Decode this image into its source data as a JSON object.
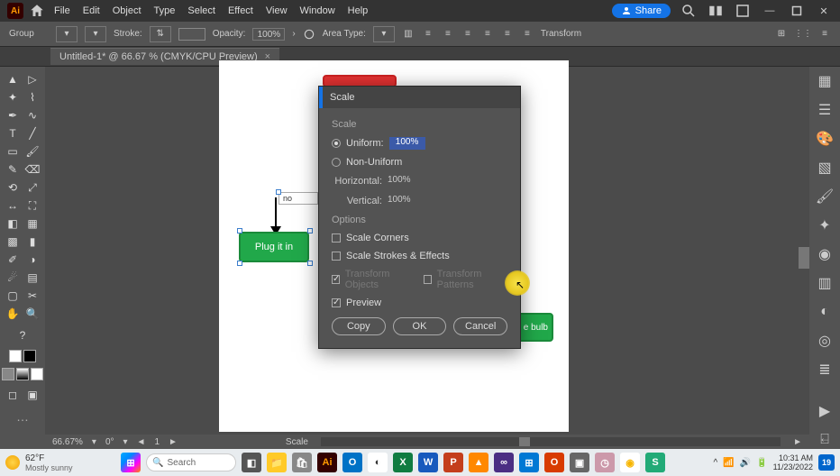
{
  "menubar": {
    "items": [
      "File",
      "Edit",
      "Object",
      "Type",
      "Select",
      "Effect",
      "View",
      "Window",
      "Help"
    ],
    "share": "Share"
  },
  "controlbar": {
    "group": "Group",
    "stroke": "Stroke:",
    "opacity": "Opacity:",
    "opacity_val": "100%",
    "areatype": "Area Type:",
    "transform": "Transform"
  },
  "tab": {
    "title": "Untitled-1* @ 66.67 % (CMYK/CPU Preview)"
  },
  "canvas": {
    "box1": "Plug it in",
    "box2": "e bulb",
    "no_label": "no"
  },
  "dialog": {
    "title": "Scale",
    "scale_section": "Scale",
    "uniform": "Uniform:",
    "uniform_val": "100%",
    "nonuniform": "Non-Uniform",
    "horizontal": "Horizontal:",
    "horizontal_val": "100%",
    "vertical": "Vertical:",
    "vertical_val": "100%",
    "options": "Options",
    "scale_corners": "Scale Corners",
    "scale_strokes": "Scale Strokes & Effects",
    "transform_objects": "Transform Objects",
    "transform_patterns": "Transform Patterns",
    "preview": "Preview",
    "copy": "Copy",
    "ok": "OK",
    "cancel": "Cancel"
  },
  "statusbar": {
    "zoom": "66.67%",
    "rot": "0°",
    "artboard": "1",
    "tool": "Scale"
  },
  "taskbar": {
    "temp": "62°F",
    "cond": "Mostly sunny",
    "search": "Search",
    "time": "10:31 AM",
    "date": "11/23/2022"
  },
  "colors": {
    "accent": "#1473e6",
    "panel": "#535353",
    "dark": "#333333"
  }
}
